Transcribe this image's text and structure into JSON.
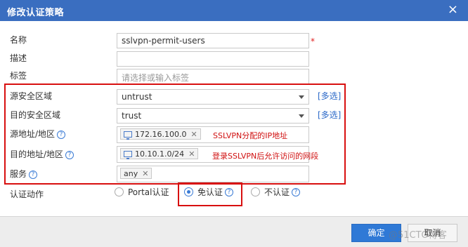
{
  "dialog": {
    "title": "修改认证策略",
    "close_glyph": "×"
  },
  "fields": {
    "name": {
      "label": "名称",
      "value": "sslvpn-permit-users",
      "required_mark": "*"
    },
    "description": {
      "label": "描述",
      "value": ""
    },
    "tag": {
      "label": "标签",
      "placeholder": "请选择或输入标签"
    },
    "source_zone": {
      "label": "源安全区域",
      "value": "untrust",
      "multi_link": "[多选]"
    },
    "dest_zone": {
      "label": "目的安全区域",
      "value": "trust",
      "multi_link": "[多选]"
    },
    "source_address": {
      "label": "源地址/地区",
      "tag": "172.16.100.0",
      "annotation": "SSLVPN分配的IP地址"
    },
    "dest_address": {
      "label": "目的地址/地区",
      "tag": "10.10.1.0/24",
      "annotation": "登录SSLVPN后允许访问的网段"
    },
    "service": {
      "label": "服务",
      "tag": "any"
    },
    "auth_action": {
      "label": "认证动作",
      "options": [
        "Portal认证",
        "免认证",
        "不认证"
      ],
      "selected": "免认证"
    }
  },
  "help_glyph": "?",
  "tag_remove_glyph": "✕",
  "buttons": {
    "ok": "确定",
    "cancel": "取消"
  },
  "watermark": "@51CTO博客",
  "colors": {
    "titlebar": "#3a6ec0",
    "annotation": "#d01010",
    "highlight_box": "#d80f0f",
    "primary_button": "#2f79d6"
  },
  "icons": [
    "close-icon",
    "help-icon",
    "monitor-icon",
    "remove-tag-icon",
    "dropdown-caret-icon"
  ]
}
